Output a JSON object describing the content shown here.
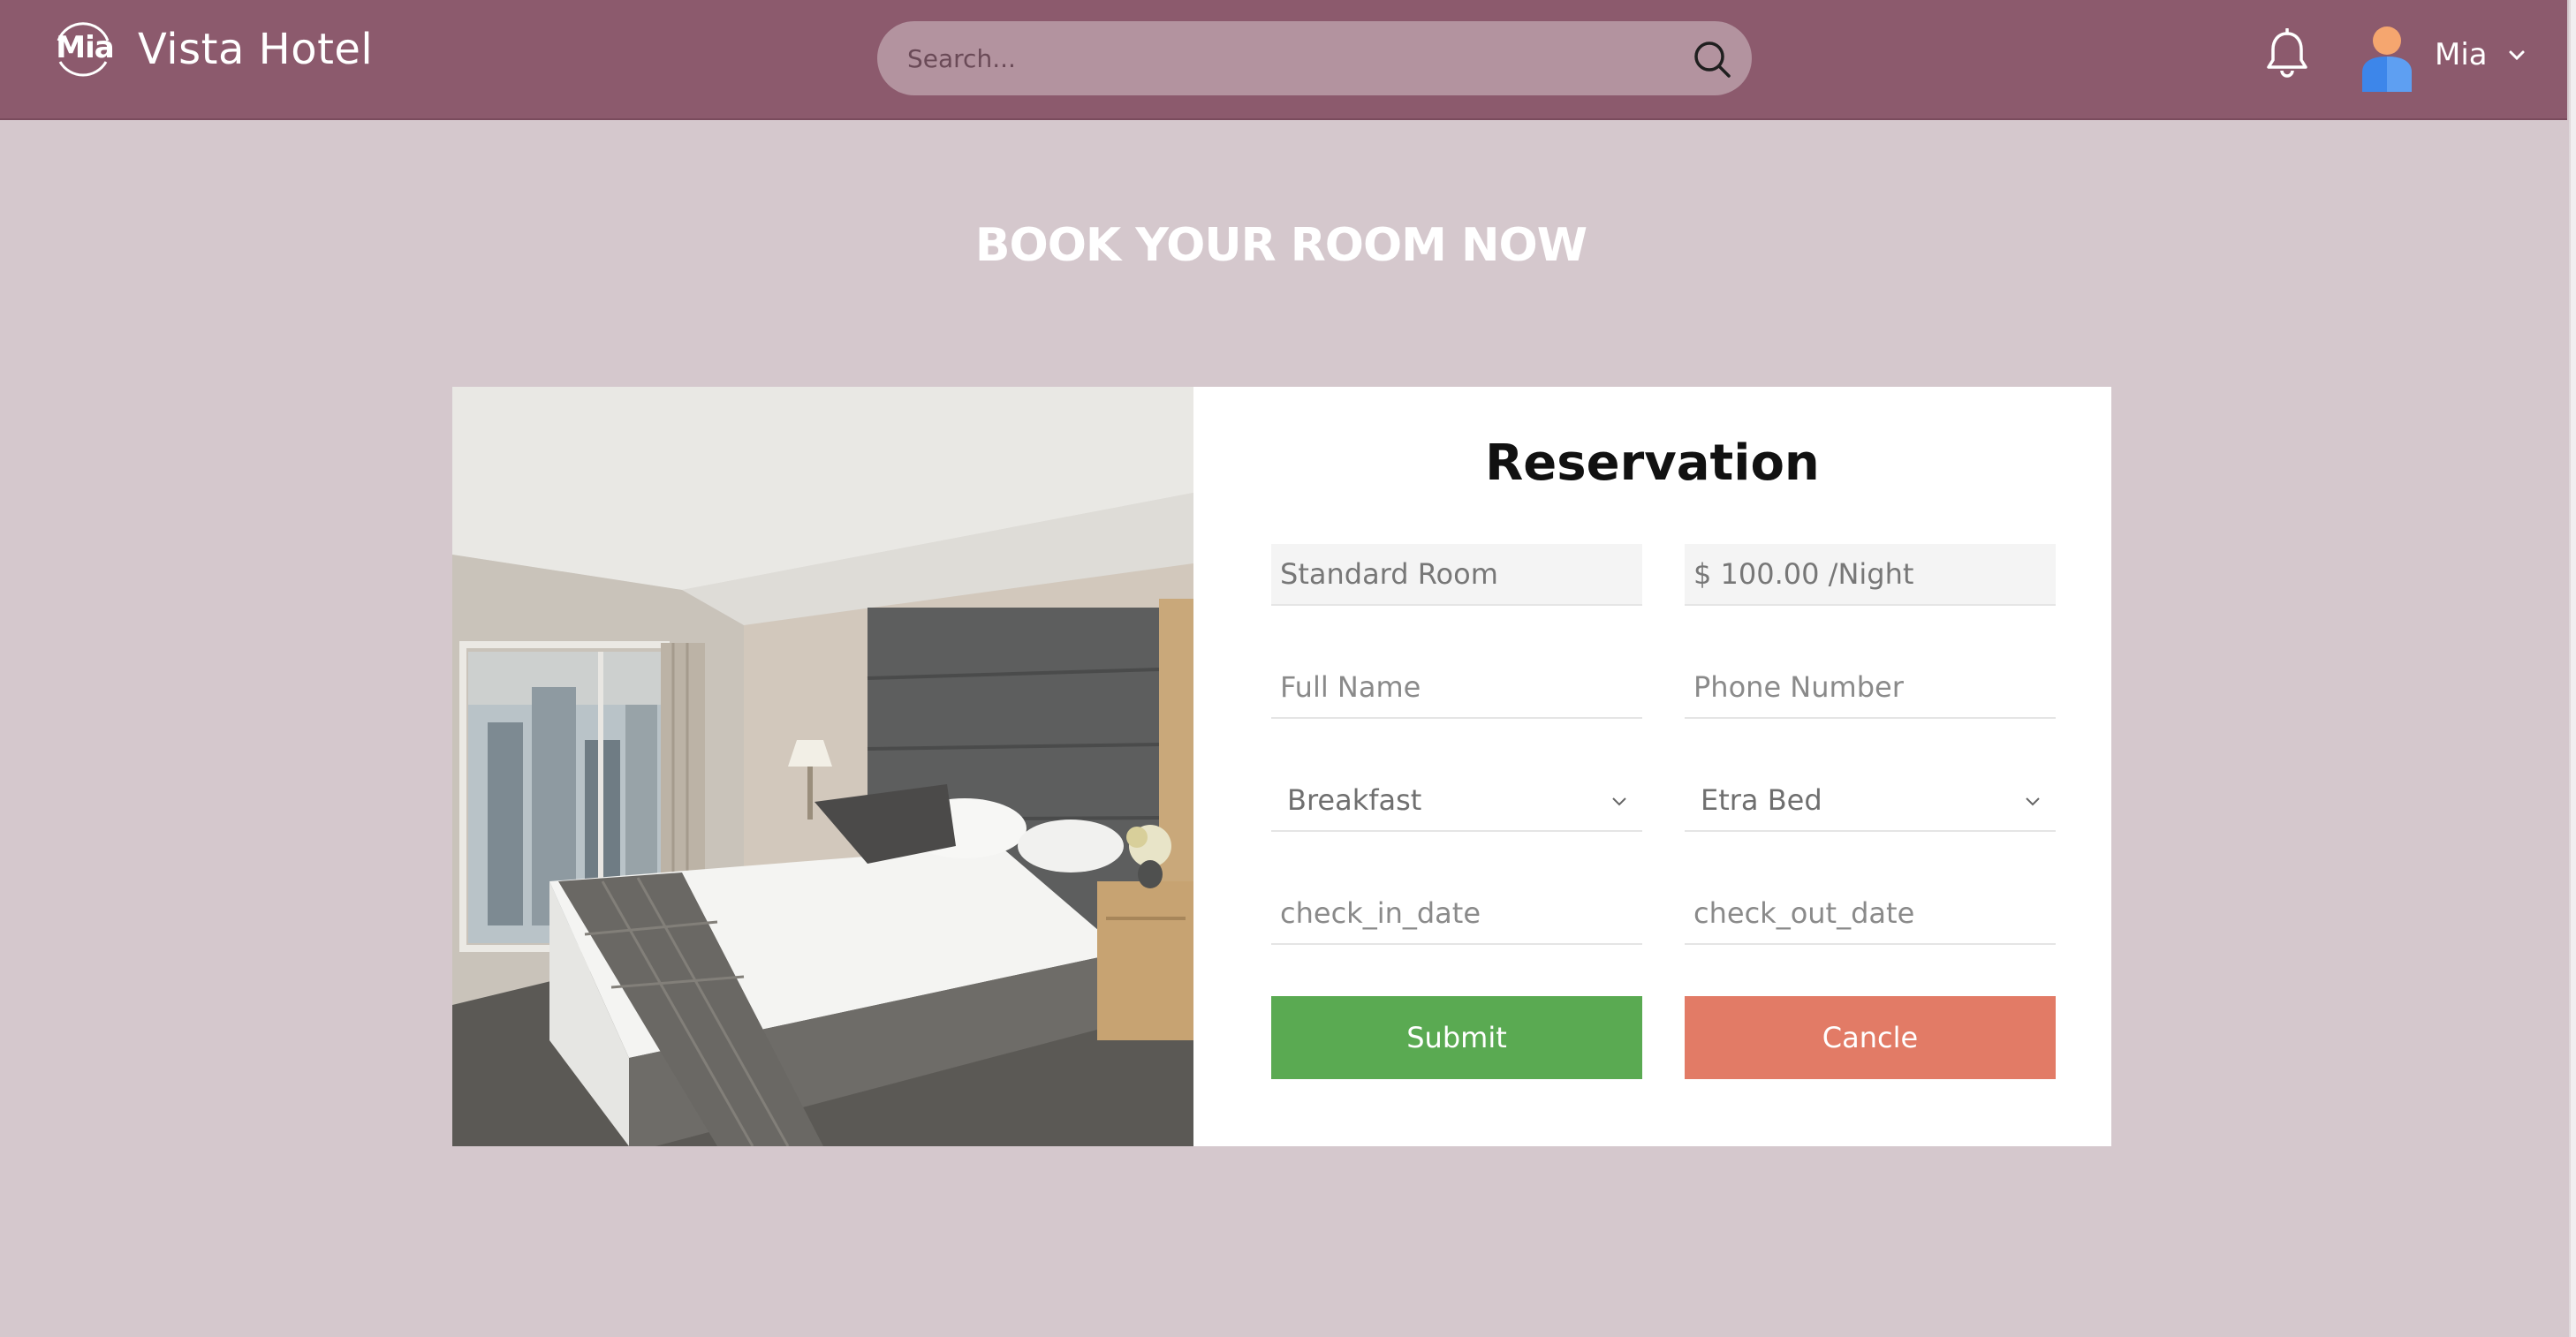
{
  "header": {
    "logo_text": "Mia",
    "brand_name": "Vista Hotel",
    "search_placeholder": "Search...",
    "user_name": "Mia"
  },
  "main": {
    "headline": "BOOK YOUR ROOM NOW"
  },
  "reservation": {
    "title": "Reservation",
    "room_type": "Standard Room",
    "price": "$ 100.00 /Night",
    "full_name_placeholder": "Full Name",
    "phone_placeholder": "Phone Number",
    "breakfast_selected": "Breakfast",
    "extra_bed_selected": "Etra Bed",
    "check_in_placeholder": "check_in_date",
    "check_out_placeholder": "check_out_date",
    "submit_label": "Submit",
    "cancel_label": "Cancle"
  },
  "colors": {
    "header_bg": "#8c5a6d",
    "page_bg": "#d5c8cd",
    "submit_bg": "#5aaa52",
    "cancel_bg": "#e27b66"
  },
  "icons": [
    "logo-icon",
    "search-icon",
    "bell-icon",
    "user-avatar-icon",
    "chevron-down-icon"
  ]
}
